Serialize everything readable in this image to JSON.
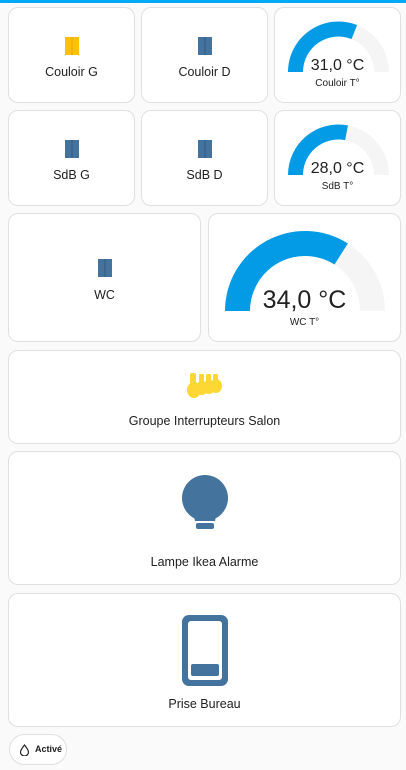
{
  "colors": {
    "window_open": "#ffc107",
    "window_closed": "#44739e",
    "gauge_fill": "#039be5",
    "gauge_track": "#f5f5f5",
    "bulb": "#44739e",
    "outlet": "#44739e",
    "group_icon": "#fdd835"
  },
  "gauge_range": {
    "min": 0,
    "max": 50
  },
  "tiles": [
    {
      "label": "Couloir G",
      "icon": "window-open-icon"
    },
    {
      "label": "Couloir D",
      "icon": "window-closed-icon"
    },
    {
      "label": "SdB G",
      "icon": "window-closed-icon"
    },
    {
      "label": "SdB D",
      "icon": "window-closed-icon"
    },
    {
      "label": "WC",
      "icon": "window-closed-icon"
    }
  ],
  "gauges": [
    {
      "value": 31.0,
      "display": "31,0 °C",
      "name": "Couloir T°"
    },
    {
      "value": 28.0,
      "display": "28,0 °C",
      "name": "SdB T°"
    },
    {
      "value": 34.0,
      "display": "34,0 °C",
      "name": "WC T°"
    }
  ],
  "group": {
    "label": "Groupe Interrupteurs Salon",
    "icon": "lightbulb-group-icon"
  },
  "lamp": {
    "label": "Lampe Ikea Alarme",
    "icon": "lightbulb-icon"
  },
  "outlet": {
    "label": "Prise Bureau",
    "icon": "power-socket-icon"
  },
  "chip": {
    "label": "Activé",
    "icon": "water-drop-icon"
  }
}
